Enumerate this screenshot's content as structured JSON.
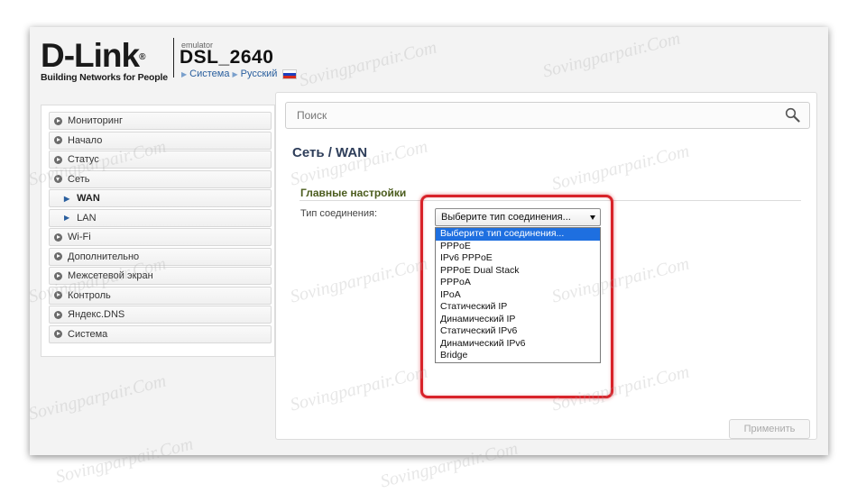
{
  "header": {
    "brand": "D-Link",
    "brand_tm": "®",
    "tagline": "Building Networks for People",
    "emulator_label": "emulator",
    "model": "DSL_2640",
    "breadcrumb": [
      "Система",
      "Русский"
    ]
  },
  "sidebar": {
    "items": [
      {
        "label": "Мониторинг"
      },
      {
        "label": "Начало"
      },
      {
        "label": "Статус"
      },
      {
        "label": "Сеть"
      },
      {
        "label": "WAN"
      },
      {
        "label": "LAN"
      },
      {
        "label": "Wi-Fi"
      },
      {
        "label": "Дополнительно"
      },
      {
        "label": "Межсетевой экран"
      },
      {
        "label": "Контроль"
      },
      {
        "label": "Яндекс.DNS"
      },
      {
        "label": "Система"
      }
    ]
  },
  "search": {
    "placeholder": "Поиск"
  },
  "main": {
    "title": "Сеть /  WAN",
    "section_title": "Главные настройки",
    "field_label": "Тип соединения:",
    "select_value": "Выберите тип соединения...",
    "options": [
      "Выберите тип соединения...",
      "PPPoE",
      "IPv6 PPPoE",
      "PPPoE Dual Stack",
      "PPPoA",
      "IPoA",
      "Статический IP",
      "Динамический IP",
      "Статический IPv6",
      "Динамический IPv6",
      "Bridge"
    ],
    "apply_label": "Применить"
  },
  "watermark": {
    "text": "Sovingparpair.Com"
  },
  "colors": {
    "highlight": "#d8232a",
    "selected_option": "#1e6fe0",
    "link": "#2a5f9e",
    "section_title": "#4b5c1e"
  },
  "icons": {
    "search": "magnifier-icon",
    "nav_bullet": "circle-arrow-icon",
    "sub_bullet": "chevron-right-icon"
  }
}
